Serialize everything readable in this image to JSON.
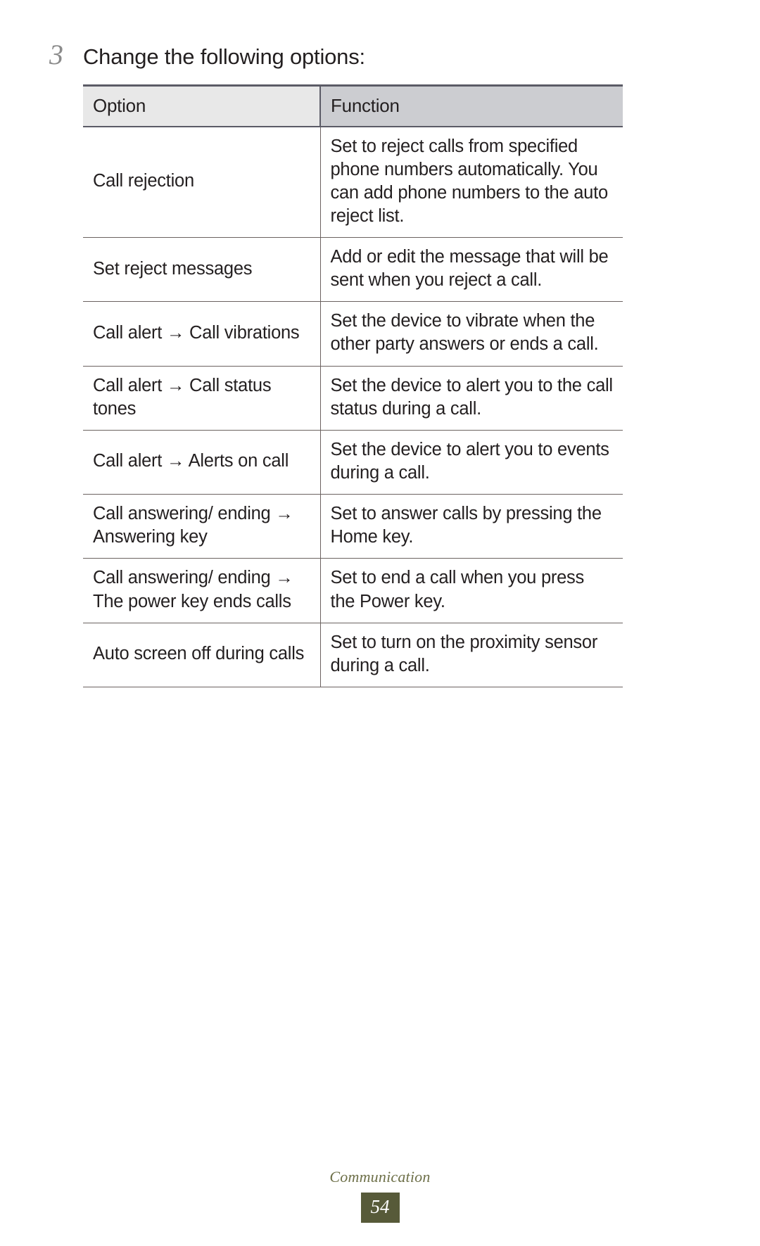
{
  "step": {
    "number": "3",
    "instruction": "Change the following options:"
  },
  "table": {
    "headers": {
      "option": "Option",
      "function": "Function"
    },
    "rows": [
      {
        "option": "Call rejection",
        "function": "Set to reject calls from specified phone numbers automatically. You can add phone numbers to the auto reject list."
      },
      {
        "option": "Set reject messages",
        "function": "Add or edit the message that will be sent when you reject a call."
      },
      {
        "option": "Call alert → Call vibrations",
        "function": "Set the device to vibrate when the other party answers or ends a call."
      },
      {
        "option": "Call alert → Call status tones",
        "function": "Set the device to alert you to the call status during a call."
      },
      {
        "option": "Call alert → Alerts on call",
        "function": "Set the device to alert you to events during a call."
      },
      {
        "option": "Call answering/ ending → Answering key",
        "function": "Set to answer calls by pressing the Home key."
      },
      {
        "option": "Call answering/ ending → The power key ends calls",
        "function": "Set to end a call when you press the Power key."
      },
      {
        "option": "Auto screen off during calls",
        "function": "Set to turn on the proximity sensor during a call."
      }
    ]
  },
  "footer": {
    "section": "Communication",
    "page_number": "54"
  },
  "colors": {
    "header_option_bg": "#e8e8e8",
    "header_function_bg": "#cccdd1",
    "rule": "#5b5b66",
    "row_rule": "#6b6260",
    "text": "#231f20",
    "step_number": "#8b8b8b",
    "footer_text": "#6e7049",
    "page_box_bg": "#575a39"
  }
}
